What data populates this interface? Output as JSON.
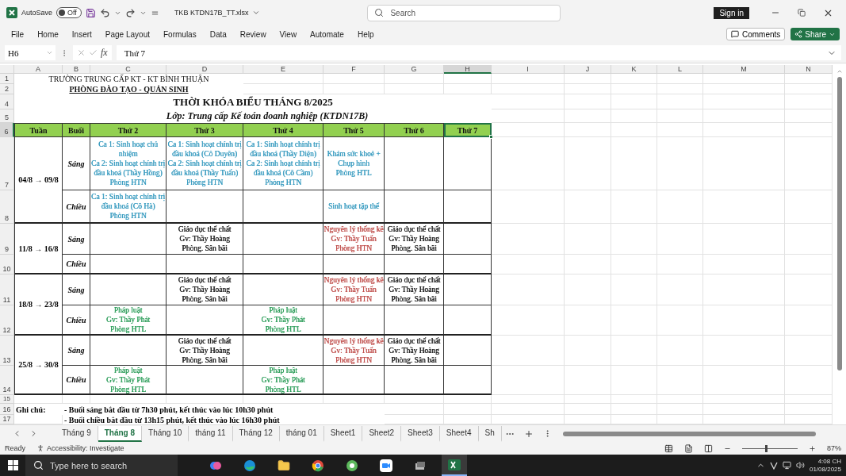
{
  "title_bar": {
    "autosave_label": "AutoSave",
    "autosave": {
      "on": false,
      "label": "Off"
    },
    "file_name": "TKB KTDN17B_TT.xlsx",
    "search_placeholder": "Search",
    "sign_in": "Sign in"
  },
  "ribbon_tabs": [
    "File",
    "Home",
    "Insert",
    "Page Layout",
    "Formulas",
    "Data",
    "Review",
    "View",
    "Automate",
    "Help"
  ],
  "comments": "Comments",
  "share": "Share",
  "formula_bar": {
    "name_box": "H6",
    "function_label": "fx",
    "formula": "Thứ 7"
  },
  "columns": [
    {
      "label": "A",
      "selected": false
    },
    {
      "label": "B",
      "selected": false
    },
    {
      "label": "C",
      "selected": false
    },
    {
      "label": "D",
      "selected": false
    },
    {
      "label": "E",
      "selected": false
    },
    {
      "label": "F",
      "selected": false
    },
    {
      "label": "G",
      "selected": false
    },
    {
      "label": "H",
      "selected": true
    },
    {
      "label": "I",
      "selected": false
    },
    {
      "label": "J",
      "selected": false
    },
    {
      "label": "K",
      "selected": false
    },
    {
      "label": "L",
      "selected": false
    },
    {
      "label": "M",
      "selected": false
    },
    {
      "label": "N",
      "selected": false
    }
  ],
  "rows": [
    {
      "label": "1",
      "selected": false
    },
    {
      "label": "2",
      "selected": false
    },
    {
      "label": "4",
      "selected": false
    },
    {
      "label": "5",
      "selected": false
    },
    {
      "label": "6",
      "selected": true
    },
    {
      "label": "7",
      "selected": false
    },
    {
      "label": "8",
      "selected": false
    },
    {
      "label": "9",
      "selected": false
    },
    {
      "label": "10",
      "selected": false
    },
    {
      "label": "11",
      "selected": false
    },
    {
      "label": "12",
      "selected": false
    },
    {
      "label": "13",
      "selected": false
    },
    {
      "label": "14",
      "selected": false
    },
    {
      "label": "15",
      "selected": false
    },
    {
      "label": "16",
      "selected": false
    },
    {
      "label": "17",
      "selected": false
    }
  ],
  "sheet": {
    "school": "TRƯỜNG TRUNG CẤP KT - KT BÌNH THUẬN",
    "department": "PHÒNG ĐÀO TẠO - QUẢN SINH",
    "title": "THỜI KHÓA BIỂU THÁNG 8/2025",
    "class_line": "Lớp: Trung cấp Kế toán doanh nghiệp (KTDN17B)",
    "headers": [
      {
        "label": "Tuần",
        "selected": false
      },
      {
        "label": "Buổi",
        "selected": false
      },
      {
        "label": "Thứ 2",
        "selected": false
      },
      {
        "label": "Thứ 3",
        "selected": false
      },
      {
        "label": "Thứ 4",
        "selected": false
      },
      {
        "label": "Thứ 5",
        "selected": false
      },
      {
        "label": "Thứ 6",
        "selected": false
      },
      {
        "label": "Thứ 7",
        "selected": true
      }
    ],
    "weeks": [
      {
        "range": "04/8 → 09/8",
        "sessions": [
          {
            "name": "Sáng",
            "cells": [
              {
                "text": "Ca 1: Sinh hoạt chủ\nnhiệm\nCa 2: Sinh hoạt chính trị\nđầu khoá (Thầy Hồng)\nPhòng HTN",
                "color": "#3a9cc0"
              },
              {
                "text": "Ca 1: Sinh hoạt chính trị\nđầu khoá (Cô Duyên)\nCa 2: Sinh hoạt chính trị\nđầu khoá (Thầy Tuấn)\nPhòng HTN",
                "color": "#3a9cc0"
              },
              {
                "text": "Ca 1: Sinh hoạt chính trị\nđầu khoá (Thầy Diện)\nCa 2: Sinh hoạt chính trị\nđầu khoá (Cô Cầm)\nPhòng HTN",
                "color": "#3a9cc0"
              },
              {
                "text": "Khám sức khoẻ +\nChụp hình\nPhòng HTL",
                "color": "#3a9cc0"
              },
              null,
              null
            ]
          },
          {
            "name": "Chiều",
            "cells": [
              {
                "text": "Ca 1: Sinh hoạt chính trị\nđầu khoá (Cô Hà)\nPhòng HTN",
                "color": "#3a9cc0"
              },
              null,
              null,
              {
                "text": "Sinh hoạt tập thể",
                "color": "#3a9cc0"
              },
              null,
              null
            ]
          }
        ]
      },
      {
        "range": "11/8 → 16/8",
        "sessions": [
          {
            "name": "Sáng",
            "cells": [
              null,
              {
                "text": "Giáo dục thể chất\nGv: Thầy Hoàng\nPhòng. Sân bãi",
                "color": "#222222"
              },
              null,
              {
                "text": "Nguyên lý thống kê\nGv: Thầy Tuấn\nPhòng HTN",
                "color": "#c0504d"
              },
              {
                "text": "Giáo dục thể chất\nGv: Thầy Hoàng\nPhòng. Sân bãi",
                "color": "#222222"
              },
              null
            ]
          },
          {
            "name": "Chiều",
            "cells": [
              null,
              null,
              null,
              null,
              null,
              null
            ]
          }
        ]
      },
      {
        "range": "18/8 → 23/8",
        "sessions": [
          {
            "name": "Sáng",
            "cells": [
              null,
              {
                "text": "Giáo dục thể chất\nGv: Thầy Hoàng\nPhòng. Sân bãi",
                "color": "#222222"
              },
              null,
              {
                "text": "Nguyên lý thống kê\nGv: Thầy Tuấn\nPhòng HTN",
                "color": "#c0504d"
              },
              {
                "text": "Giáo dục thể chất\nGv: Thầy Hoàng\nPhòng. Sân bãi",
                "color": "#222222"
              },
              null
            ]
          },
          {
            "name": "Chiều",
            "cells": [
              {
                "text": "Pháp luật\nGv: Thầy Phát\nPhòng HTL",
                "color": "#2e9e5b"
              },
              null,
              {
                "text": "Pháp luật\nGv: Thầy Phát\nPhòng HTL",
                "color": "#2e9e5b"
              },
              null,
              null,
              null
            ]
          }
        ]
      },
      {
        "range": "25/8 → 30/8",
        "sessions": [
          {
            "name": "Sáng",
            "cells": [
              null,
              {
                "text": "Giáo dục thể chất\nGv: Thầy Hoàng\nPhòng. Sân bãi",
                "color": "#222222"
              },
              null,
              {
                "text": "Nguyên lý thống kê\nGv: Thầy Tuấn\nPhòng HTN",
                "color": "#c0504d"
              },
              {
                "text": "Giáo dục thể chất\nGv: Thầy Hoàng\nPhòng. Sân bãi",
                "color": "#222222"
              },
              null
            ]
          },
          {
            "name": "Chiều",
            "cells": [
              {
                "text": "Pháp luật\nGv: Thầy Phát\nPhòng HTL",
                "color": "#2e9e5b"
              },
              null,
              {
                "text": "Pháp luật\nGv: Thầy Phát\nPhòng HTL",
                "color": "#2e9e5b"
              },
              null,
              null,
              null
            ]
          }
        ]
      }
    ],
    "notes_label": "Ghi chú:",
    "notes": [
      "- Buổi sáng bắt đầu từ 7h30 phút, kết thúc vào lúc 10h30 phút",
      "- Buổi chiều bắt đầu từ 13h15 phút, kết thúc vào lúc 16h30 phút"
    ]
  },
  "sheet_tabs": [
    {
      "label": "Tháng 9",
      "selected": false
    },
    {
      "label": "Tháng 8",
      "selected": true
    },
    {
      "label": "Tháng 10",
      "selected": false
    },
    {
      "label": "tháng 11",
      "selected": false
    },
    {
      "label": "Tháng 12",
      "selected": false
    },
    {
      "label": "tháng 01",
      "selected": false
    },
    {
      "label": "Sheet1",
      "selected": false
    },
    {
      "label": "Sheet2",
      "selected": false
    },
    {
      "label": "Sheet3",
      "selected": false
    },
    {
      "label": "Sheet4",
      "selected": false
    },
    {
      "label": "Sh",
      "selected": false
    }
  ],
  "status_bar": {
    "mode": "Ready",
    "accessibility": "Accessibility: Investigate",
    "zoom": {
      "level": 0.42,
      "label": "87%"
    }
  },
  "taskbar": {
    "search_placeholder": "Type here to search",
    "time": "4:08 CH",
    "date": "01/08/2025"
  }
}
